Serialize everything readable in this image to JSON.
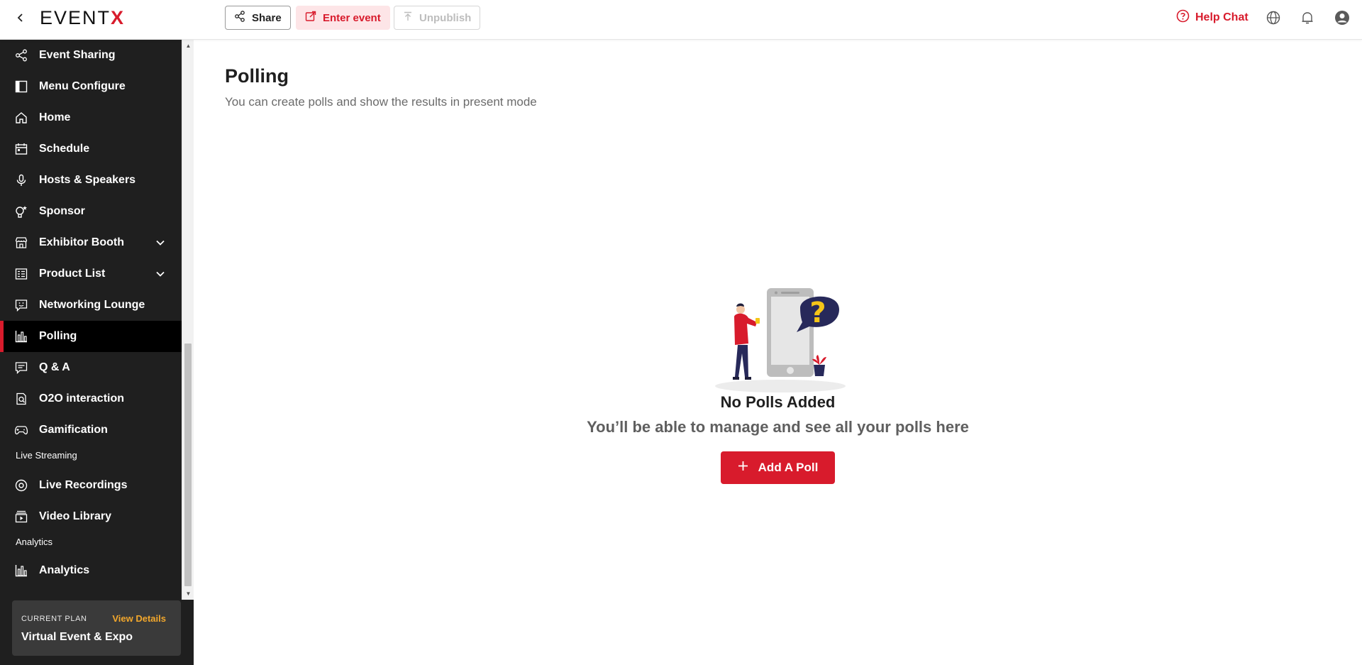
{
  "header": {
    "logo_text": "EVENT",
    "logo_x": "X",
    "share_label": "Share",
    "enter_label": "Enter event",
    "unpublish_label": "Unpublish",
    "help_label": "Help Chat",
    "icons": [
      "back-icon",
      "share-icon",
      "external-link-icon",
      "upload-icon",
      "help-circle-icon",
      "globe-icon",
      "bell-icon",
      "user-account-icon"
    ]
  },
  "sidebar": {
    "items": [
      {
        "label": "Event Sharing",
        "icon": "share-icon"
      },
      {
        "label": "Menu Configure",
        "icon": "layout-icon"
      },
      {
        "label": "Home",
        "icon": "home-icon"
      },
      {
        "label": "Schedule",
        "icon": "calendar-icon"
      },
      {
        "label": "Hosts & Speakers",
        "icon": "microphone-icon"
      },
      {
        "label": "Sponsor",
        "icon": "sponsor-icon"
      },
      {
        "label": "Exhibitor Booth",
        "icon": "store-icon"
      },
      {
        "label": "Product List",
        "icon": "list-icon"
      },
      {
        "label": "Networking Lounge",
        "icon": "chat-smile-icon"
      },
      {
        "label": "Polling",
        "icon": "bar-chart-icon"
      },
      {
        "label": "Q & A",
        "icon": "message-icon"
      },
      {
        "label": "O2O interaction",
        "icon": "o2o-icon"
      },
      {
        "label": "Gamification",
        "icon": "gamepad-icon"
      },
      {
        "label": "Live Recordings",
        "icon": "record-icon"
      },
      {
        "label": "Video Library",
        "icon": "video-library-icon"
      },
      {
        "label": "Analytics",
        "icon": "bar-chart-icon"
      }
    ],
    "section_live": "Live Streaming",
    "section_analytics": "Analytics",
    "active": "Polling",
    "plan": {
      "label": "CURRENT PLAN",
      "view_label": "View Details",
      "name": "Virtual Event & Expo"
    }
  },
  "main": {
    "title": "Polling",
    "subtitle": "You can create polls and show the results in present mode",
    "empty_title": "No Polls Added",
    "empty_desc": "You’ll be able to manage and see all your polls here",
    "add_label": "Add A Poll"
  },
  "colors": {
    "accent": "#d81b2c",
    "sidebar_bg": "#1f1f1f",
    "plan_link": "#f2a72c",
    "illustration_bubble": "#27295a",
    "illustration_question": "#f5c518"
  }
}
